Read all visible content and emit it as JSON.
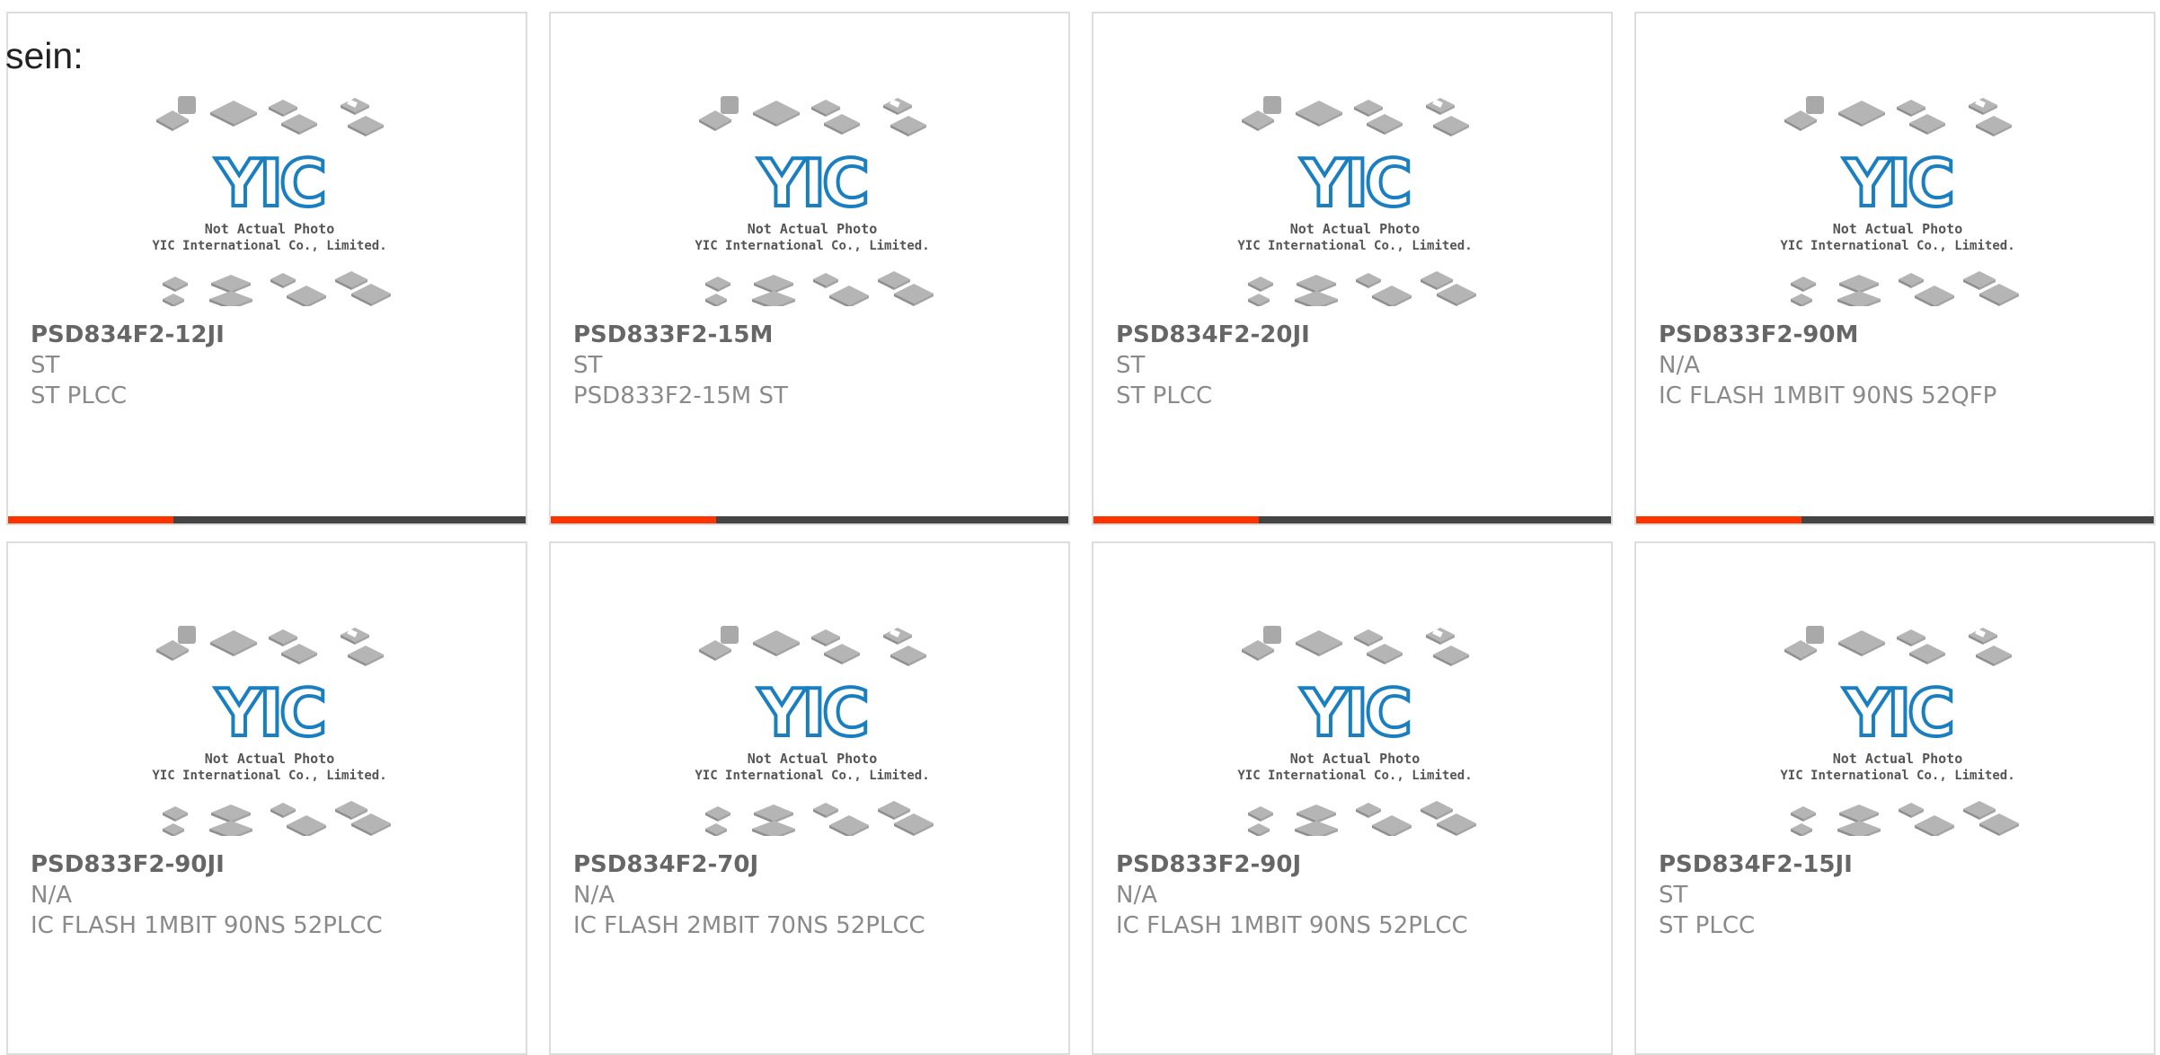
{
  "page": {
    "lead_text": "sein:"
  },
  "watermark": {
    "logo_text": "YIC",
    "line1": "Not Actual Photo",
    "line2": "YIC International Co., Limited."
  },
  "colors": {
    "accent": "#ff3300",
    "bar_track": "#444444",
    "logo_blue": "#1a7fc1",
    "chip_gray": "#b5b5b5"
  },
  "products": [
    {
      "part": "PSD834F2-12JI",
      "mfr": "ST",
      "desc": "ST PLCC",
      "progress": 0.32
    },
    {
      "part": "PSD833F2-15M",
      "mfr": "ST",
      "desc": "PSD833F2-15M ST",
      "progress": 0.32
    },
    {
      "part": "PSD834F2-20JI",
      "mfr": "ST",
      "desc": "ST PLCC",
      "progress": 0.32
    },
    {
      "part": "PSD833F2-90M",
      "mfr": "N/A",
      "desc": "IC FLASH 1MBIT 90NS 52QFP",
      "progress": 0.32
    },
    {
      "part": "PSD833F2-90JI",
      "mfr": "N/A",
      "desc": "IC FLASH 1MBIT 90NS 52PLCC"
    },
    {
      "part": "PSD834F2-70J",
      "mfr": "N/A",
      "desc": "IC FLASH 2MBIT 70NS 52PLCC"
    },
    {
      "part": "PSD833F2-90J",
      "mfr": "N/A",
      "desc": "IC FLASH 1MBIT 90NS 52PLCC"
    },
    {
      "part": "PSD834F2-15JI",
      "mfr": "ST",
      "desc": "ST PLCC"
    }
  ]
}
